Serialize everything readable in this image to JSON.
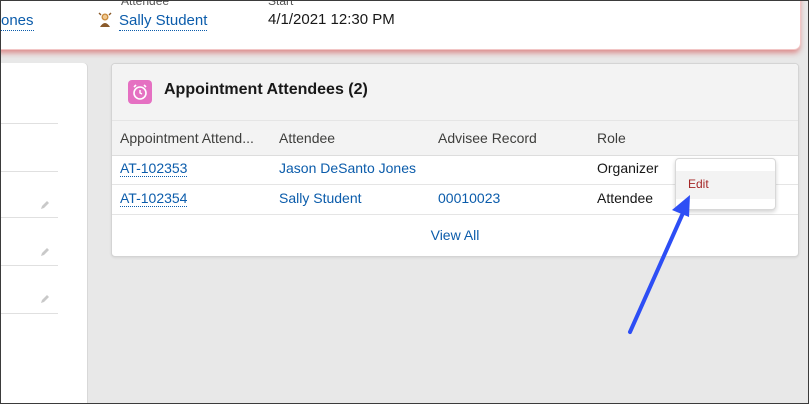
{
  "highlights": {
    "name_partial": "ones",
    "attendee_label": "Attendee",
    "attendee_value": "Sally Student",
    "start_label": "Start",
    "start_value": "4/1/2021 12:30 PM"
  },
  "card": {
    "title": "Appointment Attendees (2)",
    "icon": "alarm-clock-icon",
    "icon_color": "#e570c2",
    "columns": [
      "Appointment Attend...",
      "Attendee",
      "Advisee Record",
      "Role"
    ],
    "rows": [
      {
        "id": "AT-102353",
        "attendee": "Jason DeSanto Jones",
        "advisee_record": "",
        "role": "Organizer"
      },
      {
        "id": "AT-102354",
        "attendee": "Sally Student",
        "advisee_record": "00010023",
        "role": "Attendee"
      }
    ],
    "view_all": "View All"
  },
  "row_menu": {
    "items": [
      {
        "label": "Edit"
      }
    ]
  },
  "annotation": {
    "arrow_color": "#2d4ef5"
  }
}
